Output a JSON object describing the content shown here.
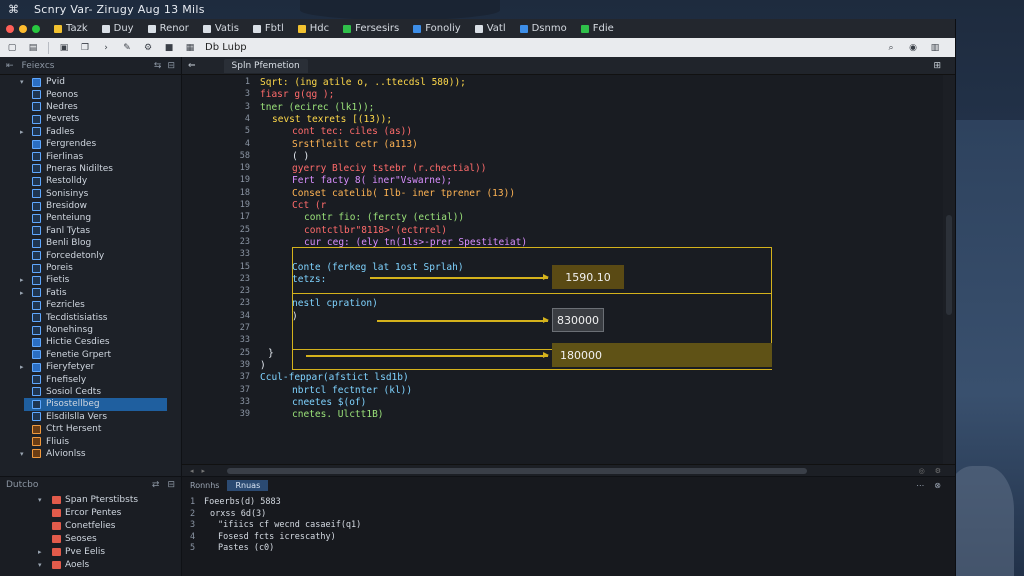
{
  "menubar": {
    "title": "Scnry Var- Zirugy Aug 13 Mils"
  },
  "window_menu": [
    {
      "label": "Tazk",
      "color": "#f2c230"
    },
    {
      "label": "Duy",
      "color": "#d9dfe6"
    },
    {
      "label": "Renor",
      "color": "#d9dfe6"
    },
    {
      "label": "Vatis",
      "color": "#d9dfe6"
    },
    {
      "label": "Fbtl",
      "color": "#d9dfe6"
    },
    {
      "label": "Hdc",
      "color": "#f2c230"
    },
    {
      "label": "Fersesirs",
      "color": "#2fbf4a"
    },
    {
      "label": "Fonoliy",
      "color": "#3d8ee8"
    },
    {
      "label": "Vatl",
      "color": "#d9dfe6"
    },
    {
      "label": "Dsnmo",
      "color": "#3d8ee8"
    },
    {
      "label": "Fdie",
      "color": "#2fbf4a"
    }
  ],
  "toolbar": {
    "label": "Db Lubp"
  },
  "sidebar": {
    "header": "Feiexcs",
    "items": [
      {
        "label": "Pvid",
        "arrow": "▾",
        "icon": "blue"
      },
      {
        "label": "Peonos",
        "arrow": "",
        "icon": ""
      },
      {
        "label": "Nedres",
        "arrow": "",
        "icon": ""
      },
      {
        "label": "Pevrets",
        "arrow": "",
        "icon": ""
      },
      {
        "label": "Fadles",
        "arrow": "▸",
        "icon": ""
      },
      {
        "label": "Fergrendes",
        "arrow": "",
        "icon": "blue"
      },
      {
        "label": "Fierlinas",
        "arrow": "",
        "icon": ""
      },
      {
        "label": "Pneras Nidiltes",
        "arrow": "",
        "icon": ""
      },
      {
        "label": "Restolldy",
        "arrow": "",
        "icon": ""
      },
      {
        "label": "Sonisinys",
        "arrow": "",
        "icon": ""
      },
      {
        "label": "Bresidow",
        "arrow": "",
        "icon": ""
      },
      {
        "label": "Penteiung",
        "arrow": "",
        "icon": ""
      },
      {
        "label": "Fanl Tytas",
        "arrow": "",
        "icon": ""
      },
      {
        "label": "Benli Blog",
        "arrow": "",
        "icon": ""
      },
      {
        "label": "Forcedetonly",
        "arrow": "",
        "icon": ""
      },
      {
        "label": "Poreis",
        "arrow": "",
        "icon": ""
      },
      {
        "label": "Fietis",
        "arrow": "▸",
        "icon": ""
      },
      {
        "label": "Fatis",
        "arrow": "▸",
        "icon": ""
      },
      {
        "label": "Fezricles",
        "arrow": "",
        "icon": ""
      },
      {
        "label": "Tecdistisiatiss",
        "arrow": "",
        "icon": ""
      },
      {
        "label": "Ronehinsg",
        "arrow": "",
        "icon": ""
      },
      {
        "label": "Hictie Cesdies",
        "arrow": "",
        "icon": "blue"
      },
      {
        "label": "Fenetie Grpert",
        "arrow": "",
        "icon": "blue"
      },
      {
        "label": "Fieryfetyer",
        "arrow": "▸",
        "icon": "blue"
      },
      {
        "label": "Fnefisely",
        "arrow": "",
        "icon": ""
      },
      {
        "label": "Sosiol Cedts",
        "arrow": "",
        "icon": ""
      },
      {
        "label": "Pisostellbeg",
        "arrow": "",
        "icon": "",
        "selected": true
      },
      {
        "label": "Elsdilslla Vers",
        "arrow": "",
        "icon": ""
      },
      {
        "label": "Ctrt Hersent",
        "arrow": "",
        "icon": "orange"
      },
      {
        "label": "Fliuis",
        "arrow": "",
        "icon": "orange"
      },
      {
        "label": "Alvionlss",
        "arrow": "▾",
        "icon": "orange"
      }
    ]
  },
  "bottom_sidebar": {
    "header": "Dutcbo",
    "items": [
      {
        "label": "Span Pterstibsts",
        "arrow": "▾"
      },
      {
        "label": "Ercor Pentes",
        "arrow": ""
      },
      {
        "label": "Conetfelies",
        "arrow": ""
      },
      {
        "label": "Seoses",
        "arrow": ""
      },
      {
        "label": "Pve Eelis",
        "arrow": "▸"
      },
      {
        "label": "Aoels",
        "arrow": "▾"
      }
    ]
  },
  "editor": {
    "tab": "Spln Pfemetion",
    "lines": [
      {
        "n": "1",
        "text": "Sqrt: (ing atile o, ..ttecdsl 580));",
        "indent": 0,
        "color": "k-yel"
      },
      {
        "n": "3",
        "text": "fiasr g(qg );",
        "indent": 0,
        "color": "k-red"
      },
      {
        "n": "3",
        "text": "tner (ecirec (lk1));",
        "indent": 0,
        "color": "k-grn"
      },
      {
        "n": "4",
        "text": "sevst texrets [(13));",
        "indent": 12,
        "color": "k-yel"
      },
      {
        "n": "5",
        "text": "cont tec: ciles (as))",
        "indent": 32,
        "color": "k-red"
      },
      {
        "n": "4",
        "text": "Srstfleilt cetr (a113)",
        "indent": 32,
        "color": "k-org"
      },
      {
        "n": "58",
        "text": "( )",
        "indent": 32,
        "color": "k-wht"
      },
      {
        "n": "19",
        "text": "gyerry Bleciy tstebr (r.chectial))",
        "indent": 32,
        "color": "k-red"
      },
      {
        "n": "19",
        "text": "Fert facty 8( iner\"Vswarne);",
        "indent": 32,
        "color": "k-pur"
      },
      {
        "n": "18",
        "text": "Conset catelib( Ilb- iner tprener (13))",
        "indent": 32,
        "color": "k-org"
      },
      {
        "n": "19",
        "text": "Cct (r",
        "indent": 32,
        "color": "k-red"
      },
      {
        "n": "17",
        "text": "contr fio: (fercty (ectial))",
        "indent": 44,
        "color": "k-grn"
      },
      {
        "n": "25",
        "text": "contctlbr\"8118>'(ectrrel)",
        "indent": 44,
        "color": "k-red"
      },
      {
        "n": "23",
        "text": "cur ceg: (ely tn(1ls>-prer Spestiteiat)",
        "indent": 44,
        "color": "k-pur"
      },
      {
        "n": "33",
        "text": "",
        "indent": 32,
        "color": "k-wht"
      },
      {
        "n": "15",
        "text": "Conte (ferkeg lat 1ost Sprlah)",
        "indent": 32,
        "color": "k-cyan"
      },
      {
        "n": "23",
        "text": "tetzs:",
        "indent": 32,
        "color": "k-cyan"
      },
      {
        "n": "23",
        "text": "",
        "indent": 32,
        "color": "k-wht"
      },
      {
        "n": "23",
        "text": "nestl cpration)",
        "indent": 32,
        "color": "k-cyan"
      },
      {
        "n": "34",
        "text": ")",
        "indent": 32,
        "color": "k-wht"
      },
      {
        "n": "27",
        "text": "",
        "indent": 32,
        "color": "k-wht"
      },
      {
        "n": "33",
        "text": "",
        "indent": 32,
        "color": "k-wht"
      },
      {
        "n": "25",
        "text": "}",
        "indent": 8,
        "color": "k-wht"
      },
      {
        "n": "39",
        "text": ")",
        "indent": 0,
        "color": "k-wht"
      },
      {
        "n": "37",
        "text": "Ccul-feppar(afstict lsd1b)",
        "indent": 0,
        "color": "k-cyan"
      },
      {
        "n": "37",
        "text": "nbrtcl fectnter (kl))",
        "indent": 32,
        "color": "k-cyan"
      },
      {
        "n": "33",
        "text": "cneetes $(of)",
        "indent": 32,
        "color": "k-cyan"
      },
      {
        "n": "39",
        "text": "cnetes. Ulctt1B)",
        "indent": 32,
        "color": "k-grn"
      }
    ],
    "values": [
      "1590.10",
      "830000",
      "180000"
    ]
  },
  "console": {
    "tabs": [
      "Ronnhs",
      "Rnuas"
    ],
    "lines": [
      {
        "n": "1",
        "text": "Foeerbs(d) 5883",
        "indent": 0
      },
      {
        "n": "2",
        "text": "orxss 6d(3)",
        "indent": 6
      },
      {
        "n": "3",
        "text": "\"ifiics cf wecnd casaeif(q1)",
        "indent": 14
      },
      {
        "n": "4",
        "text": "Fosesd fcts icrescathy)",
        "indent": 14
      },
      {
        "n": "5",
        "text": "Pastes (c0)",
        "indent": 14
      }
    ]
  }
}
